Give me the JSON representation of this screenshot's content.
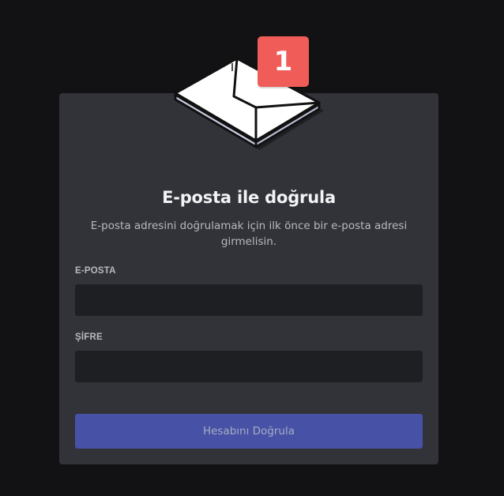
{
  "badge": {
    "count": "1",
    "color": "#f05c57"
  },
  "illustration": {
    "icon": "envelope-icon"
  },
  "card": {
    "title": "E-posta ile doğrula",
    "subtitle": "E-posta adresini doğrulamak için ilk önce bir e-posta adresi girmelisin."
  },
  "form": {
    "email_label": "E-POSTA",
    "email_value": "",
    "password_label": "ŞİFRE",
    "password_value": "",
    "submit_label": "Hesabını Doğrula"
  },
  "colors": {
    "background": "#121214",
    "card": "#323338",
    "input": "#1e1f22",
    "button": "#4752a6"
  }
}
